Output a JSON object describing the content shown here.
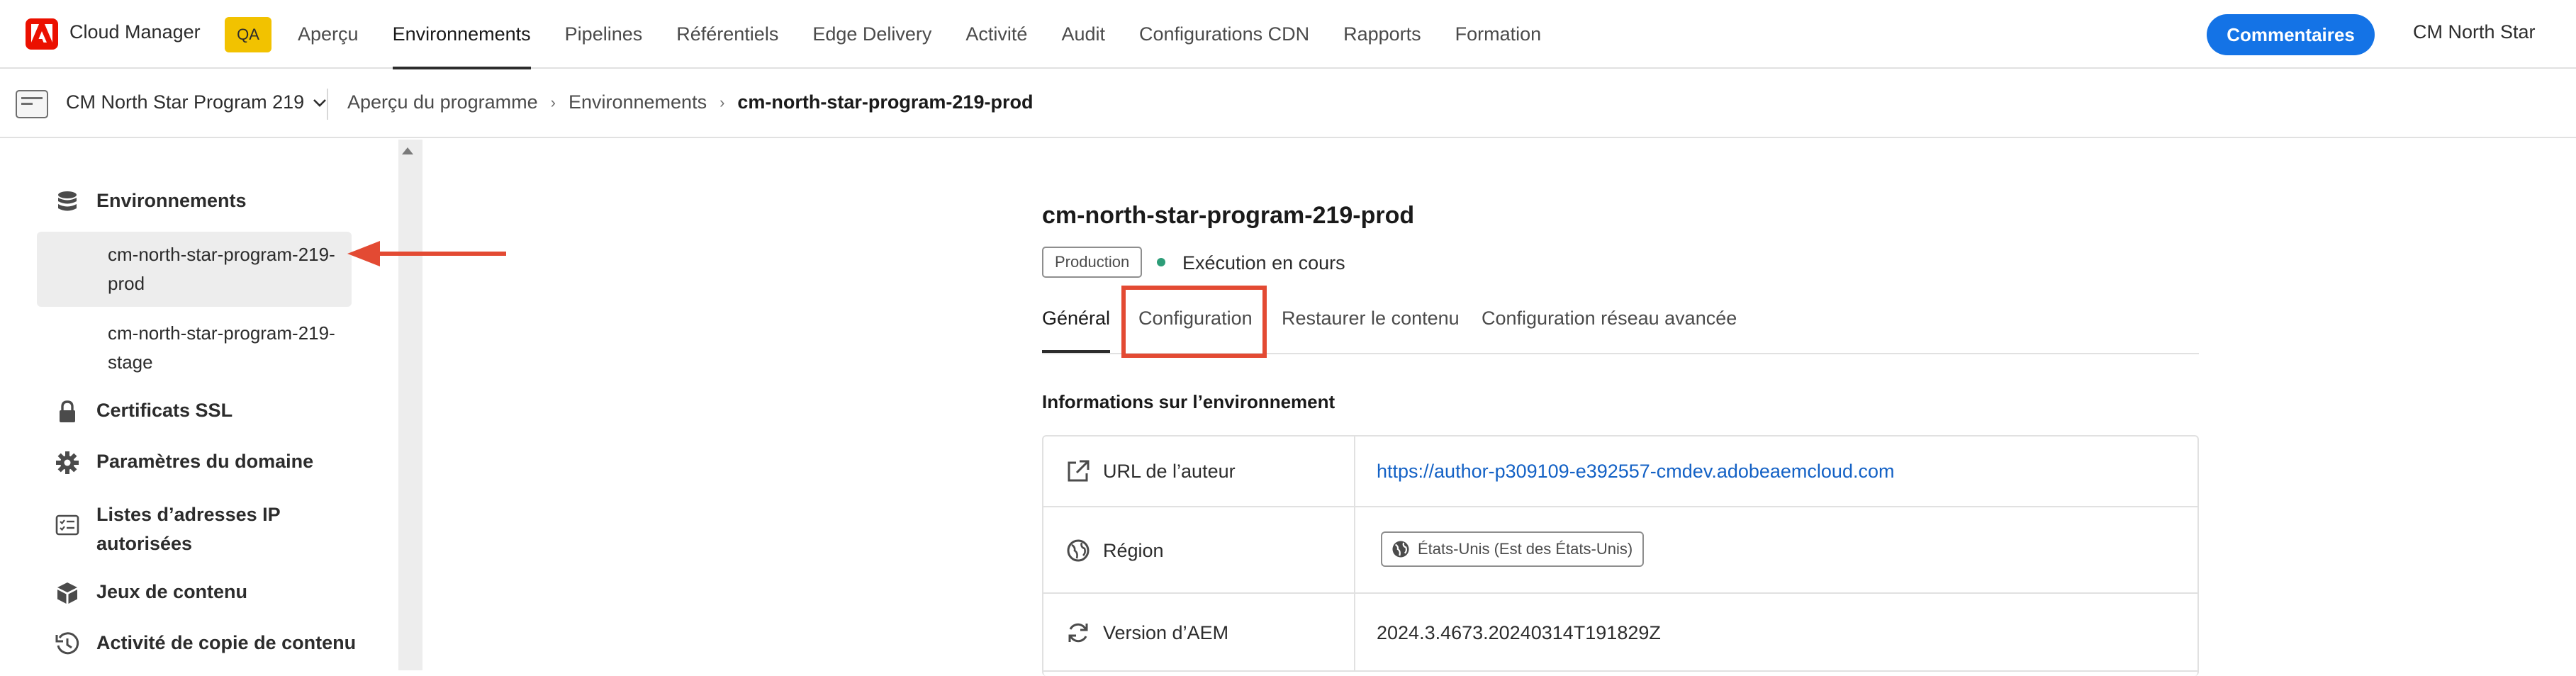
{
  "topnav": {
    "app_title": "Cloud Manager",
    "env_badge": "QA",
    "items": [
      {
        "label": "Aperçu",
        "active": false
      },
      {
        "label": "Environnements",
        "active": true
      },
      {
        "label": "Pipelines",
        "active": false
      },
      {
        "label": "Référentiels",
        "active": false
      },
      {
        "label": "Edge Delivery",
        "active": false
      },
      {
        "label": "Activité",
        "active": false
      },
      {
        "label": "Audit",
        "active": false
      },
      {
        "label": "Configurations CDN",
        "active": false
      },
      {
        "label": "Rapports",
        "active": false
      },
      {
        "label": "Formation",
        "active": false
      }
    ],
    "feedback_button": "Commentaires",
    "user_name": "CM North Star"
  },
  "subbar": {
    "program_name": "CM North Star Program 219",
    "breadcrumb": [
      "Aperçu du programme",
      "Environnements",
      "cm-north-star-program-219-prod"
    ]
  },
  "sidebar": {
    "environments_label": "Environnements",
    "env_items": [
      {
        "label_line1": "cm-north-star-program-219-",
        "label_line2": "prod",
        "selected": true
      },
      {
        "label_line1": "cm-north-star-program-219-",
        "label_line2": "stage",
        "selected": false
      }
    ],
    "ssl_label": "Certificats SSL",
    "domain_label": "Paramètres du domaine",
    "ip_label_line1": "Listes d’adresses IP",
    "ip_label_line2": "autorisées",
    "content_sets_label": "Jeux de contenu",
    "content_copy_label": "Activité de copie de contenu"
  },
  "main": {
    "env_title": "cm-north-star-program-219-prod",
    "env_type_tag": "Production",
    "status_text": "Exécution en cours",
    "tabs": [
      {
        "label": "Général",
        "active": true
      },
      {
        "label": "Configuration",
        "active": false
      },
      {
        "label": "Restaurer le contenu",
        "active": false
      },
      {
        "label": "Configuration réseau avancée",
        "active": false
      }
    ],
    "section_title": "Informations sur l’environnement",
    "info_rows": {
      "author_url_label": "URL de l’auteur",
      "author_url_value": "https://author-p309109-e392557-cmdev.adobeaemcloud.com",
      "region_label": "Région",
      "region_value": "États-Unis (Est des États-Unis)",
      "aem_version_label": "Version d’AEM",
      "aem_version_value": "2024.3.4673.20240314T191829Z"
    }
  },
  "colors": {
    "brand_red": "#eb1000",
    "qa_badge": "#f2c200",
    "primary_blue": "#1473e6",
    "link_blue": "#1361c5",
    "status_green": "#2d9d78",
    "annotation_red": "#e34a33"
  }
}
